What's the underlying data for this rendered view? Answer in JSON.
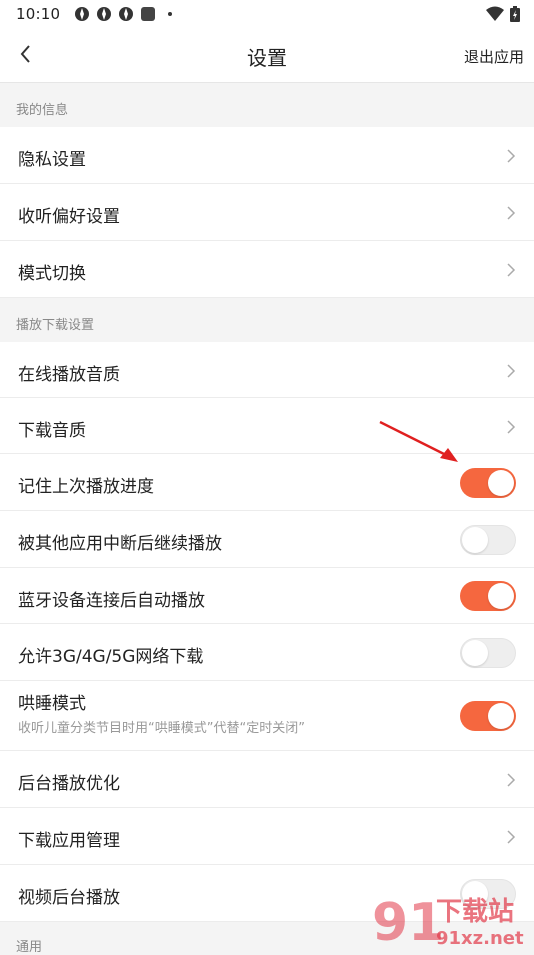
{
  "status_bar": {
    "time": "10:10",
    "icons": [
      "app-icon",
      "app-icon",
      "app-icon",
      "square-app-icon",
      "dot-icon"
    ],
    "right_icons": [
      "wifi-icon",
      "battery-icon"
    ]
  },
  "header": {
    "title": "设置",
    "exit_label": "退出应用",
    "back_icon": "chevron-left-icon"
  },
  "sections": [
    {
      "title": "我的信息",
      "rows": [
        {
          "label": "隐私设置",
          "type": "link"
        },
        {
          "label": "收听偏好设置",
          "type": "link"
        },
        {
          "label": "模式切换",
          "type": "link"
        }
      ]
    },
    {
      "title": "播放下载设置",
      "rows": [
        {
          "label": "在线播放音质",
          "type": "link"
        },
        {
          "label": "下载音质",
          "type": "link"
        },
        {
          "label": "记住上次播放进度",
          "type": "toggle",
          "on": true
        },
        {
          "label": "被其他应用中断后继续播放",
          "type": "toggle",
          "on": false
        },
        {
          "label": "蓝牙设备连接后自动播放",
          "type": "toggle",
          "on": true
        },
        {
          "label": "允许3G/4G/5G网络下载",
          "type": "toggle",
          "on": false
        },
        {
          "label": "哄睡模式",
          "sub": "收听儿童分类节目时用“哄睡模式”代替“定时关闭”",
          "type": "toggle",
          "on": true
        },
        {
          "label": "后台播放优化",
          "type": "link"
        },
        {
          "label": "下载应用管理",
          "type": "link"
        },
        {
          "label": "视频后台播放",
          "type": "toggle",
          "on": false
        }
      ]
    },
    {
      "title": "通用",
      "rows": []
    }
  ],
  "watermark": {
    "text": "下载站",
    "url": "91xz.net"
  },
  "colors": {
    "accent": "#f5673f",
    "arrow": "#e02020"
  }
}
